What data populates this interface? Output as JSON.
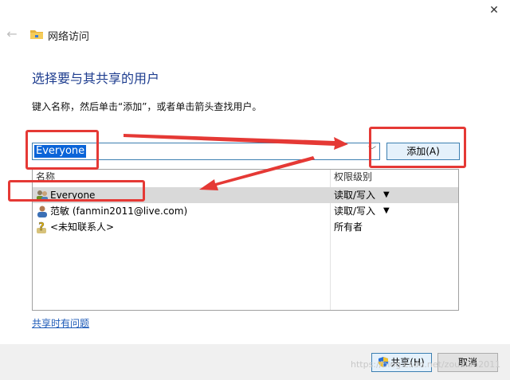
{
  "window": {
    "title": "网络访问"
  },
  "main": {
    "heading": "选择要与其共享的用户",
    "instruction": "键入名称，然后单击“添加”，或者单击箭头查找用户。",
    "input_value": "Everyone",
    "add_button": "添加(A)"
  },
  "list": {
    "columns": [
      "名称",
      "权限级别"
    ],
    "rows": [
      {
        "name": "Everyone",
        "permission": "读取/写入",
        "dropdown": "▼",
        "icon": "group-icon"
      },
      {
        "name": "范敏 (fanmin2011@live.com)",
        "permission": "读取/写入",
        "dropdown": "▼",
        "icon": "user-icon"
      },
      {
        "name": "<未知联系人>",
        "permission": "所有者",
        "dropdown": "",
        "icon": "unknown-contact-icon"
      }
    ]
  },
  "help_link": "共享时有问题",
  "footer": {
    "share_button": "共享(H)",
    "cancel_button": "取消"
  },
  "watermark": "https://blog.csdn.net/zouxiao2011",
  "colors": {
    "accent": "#1e3d8f",
    "selection": "#0a64d8",
    "annotation": "#e53935"
  }
}
